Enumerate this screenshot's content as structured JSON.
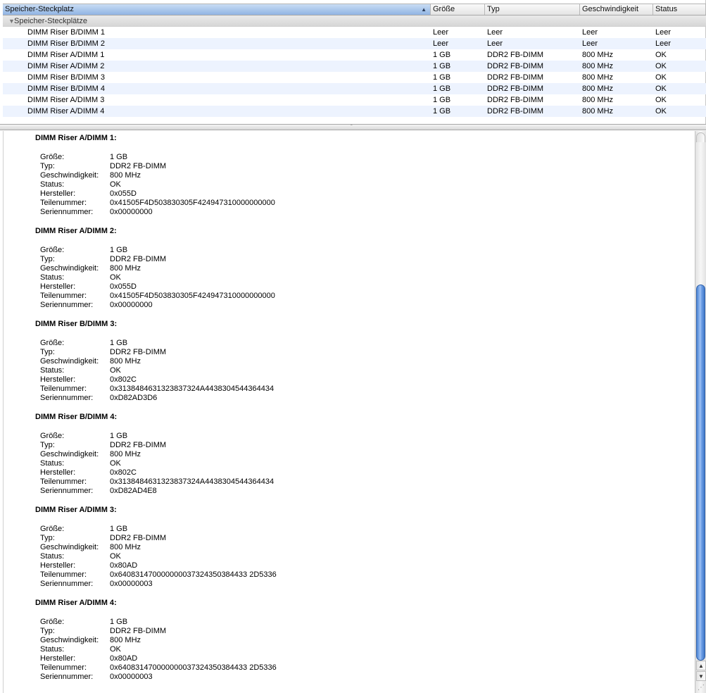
{
  "table": {
    "columns": [
      "Speicher-Steckplatz",
      "Größe",
      "Typ",
      "Geschwindigkeit",
      "Status"
    ],
    "sort_indicator": "▲",
    "group_label": "Speicher-Steckplätze",
    "rows": [
      {
        "name": "DIMM Riser B/DIMM 1",
        "size": "Leer",
        "type": "Leer",
        "speed": "Leer",
        "status": "Leer"
      },
      {
        "name": "DIMM Riser B/DIMM 2",
        "size": "Leer",
        "type": "Leer",
        "speed": "Leer",
        "status": "Leer"
      },
      {
        "name": "DIMM Riser A/DIMM 1",
        "size": "1 GB",
        "type": "DDR2 FB-DIMM",
        "speed": "800 MHz",
        "status": "OK"
      },
      {
        "name": "DIMM Riser A/DIMM 2",
        "size": "1 GB",
        "type": "DDR2 FB-DIMM",
        "speed": "800 MHz",
        "status": "OK"
      },
      {
        "name": "DIMM Riser B/DIMM 3",
        "size": "1 GB",
        "type": "DDR2 FB-DIMM",
        "speed": "800 MHz",
        "status": "OK"
      },
      {
        "name": "DIMM Riser B/DIMM 4",
        "size": "1 GB",
        "type": "DDR2 FB-DIMM",
        "speed": "800 MHz",
        "status": "OK"
      },
      {
        "name": "DIMM Riser A/DIMM 3",
        "size": "1 GB",
        "type": "DDR2 FB-DIMM",
        "speed": "800 MHz",
        "status": "OK"
      },
      {
        "name": "DIMM Riser A/DIMM 4",
        "size": "1 GB",
        "type": "DDR2 FB-DIMM",
        "speed": "800 MHz",
        "status": "OK"
      }
    ]
  },
  "detail": {
    "labels": {
      "size": "Größe:",
      "type": "Typ:",
      "speed": "Geschwindigkeit:",
      "status": "Status:",
      "manufacturer": "Hersteller:",
      "part": "Teilenummer:",
      "serial": "Seriennummer:"
    },
    "blocks": [
      {
        "title": "DIMM Riser A/DIMM 1:",
        "size": "1 GB",
        "type": "DDR2 FB-DIMM",
        "speed": "800 MHz",
        "status": "OK",
        "manufacturer": "0x055D",
        "part": "0x41505F4D503830305F424947310000000000",
        "serial": "0x00000000"
      },
      {
        "title": "DIMM Riser A/DIMM 2:",
        "size": "1 GB",
        "type": "DDR2 FB-DIMM",
        "speed": "800 MHz",
        "status": "OK",
        "manufacturer": "0x055D",
        "part": "0x41505F4D503830305F424947310000000000",
        "serial": "0x00000000"
      },
      {
        "title": "DIMM Riser B/DIMM 3:",
        "size": "1 GB",
        "type": "DDR2 FB-DIMM",
        "speed": "800 MHz",
        "status": "OK",
        "manufacturer": "0x802C",
        "part": "0x3138484631323837324A4438304544364434",
        "serial": "0xD82AD3D6"
      },
      {
        "title": "DIMM Riser B/DIMM 4:",
        "size": "1 GB",
        "type": "DDR2 FB-DIMM",
        "speed": "800 MHz",
        "status": "OK",
        "manufacturer": "0x802C",
        "part": "0x3138484631323837324A4438304544364434",
        "serial": "0xD82AD4E8"
      },
      {
        "title": "DIMM Riser A/DIMM 3:",
        "size": "1 GB",
        "type": "DDR2 FB-DIMM",
        "speed": "800 MHz",
        "status": "OK",
        "manufacturer": "0x80AD",
        "part": "0x640831470000000037324350384433 2D5336",
        "serial": "0x00000003"
      },
      {
        "title": "DIMM Riser A/DIMM 4:",
        "size": "1 GB",
        "type": "DDR2 FB-DIMM",
        "speed": "800 MHz",
        "status": "OK",
        "manufacturer": "0x80AD",
        "part": "0x640831470000000037324350384433 2D5336",
        "serial": "0x00000003"
      }
    ]
  },
  "scrollbar": {
    "position_fraction": 0.73,
    "up_arrow": "▲",
    "down_arrow": "▼"
  },
  "colors": {
    "selected_header": "#90b4e3",
    "alt_row": "#edf3fe",
    "thumb": "#4c86d6"
  }
}
